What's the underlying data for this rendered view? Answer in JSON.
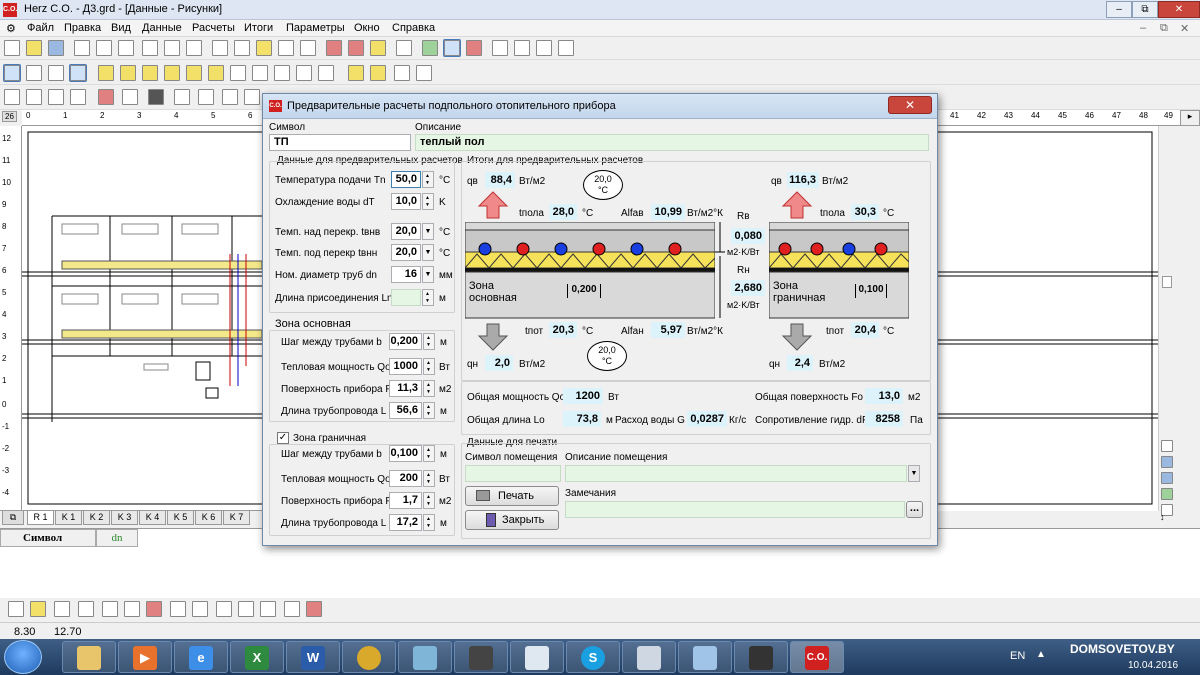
{
  "window": {
    "title": "Herz C.O. - Д3.grd - [Данные - Рисунки]",
    "logo": "C.O.",
    "min": "‒",
    "max": "⧉",
    "close": "✕"
  },
  "menu": [
    "Файл",
    "Правка",
    "Вид",
    "Данные",
    "Расчеты",
    "Итоги",
    "Параметры",
    "Окно",
    "Справка"
  ],
  "ruler_x": [
    "26",
    "0",
    "1",
    "2",
    "3",
    "4",
    "5",
    "6",
    "7",
    "8",
    "9",
    "10",
    "41",
    "42",
    "43",
    "44",
    "45",
    "46",
    "47",
    "48",
    "49",
    "50"
  ],
  "ruler_y": [
    "12",
    "11",
    "10",
    "9",
    "8",
    "7",
    "6",
    "5",
    "4",
    "3",
    "2",
    "1",
    "0",
    "-1",
    "-2",
    "-3",
    "-4"
  ],
  "sheet_tabs": [
    "R 1",
    "K 1",
    "K 2",
    "K 3",
    "K 4",
    "K 5",
    "K 6",
    "K 7"
  ],
  "grid": {
    "col1": "Символ",
    "col2": "dn"
  },
  "status": {
    "x": "8.30",
    "y": "12.70"
  },
  "taskbar": {
    "lang": "EN",
    "site": "DOMSOVETOV.BY",
    "date": "10.04.2016",
    "co_label": "C.O."
  },
  "dialog": {
    "title": "Предварительные расчеты подпольного отопительного прибора",
    "close": "✕",
    "symbol_label": "Символ",
    "symbol_value": "ТП",
    "desc_label": "Описание",
    "desc_value": "теплый пол",
    "left": {
      "section_title": "Данные для предварительных расчетов",
      "rows": [
        {
          "label": "Температура подачи  Tn",
          "value": "50,0",
          "unit": "°С",
          "ctl": "spin"
        },
        {
          "label": "Охлаждение воды dT",
          "value": "10,0",
          "unit": "K",
          "ctl": "spin"
        },
        {
          "label": "Темп. над перекр. tвнв",
          "value": "20,0",
          "unit": "°С",
          "ctl": "drop"
        },
        {
          "label": "Темп. под перекр tвнн",
          "value": "20,0",
          "unit": "°С",
          "ctl": "drop"
        },
        {
          "label": "Ном. диаметр труб dn",
          "value": "16",
          "unit": "мм",
          "ctl": "drop"
        },
        {
          "label": "Длина присоединения Ln",
          "value": "",
          "unit": "м",
          "ctl": "spin"
        }
      ],
      "main_zone": {
        "title": "Зона основная",
        "rows": [
          {
            "label": "Шаг между трубами b",
            "value": "0,200",
            "unit": "м"
          },
          {
            "label": "Тепловая мощность Qo",
            "value": "1000",
            "unit": "Вт"
          },
          {
            "label": "Поверхность прибора F",
            "value": "11,3",
            "unit": "м2"
          },
          {
            "label": "Длина трубопровода L",
            "value": "56,6",
            "unit": "м"
          }
        ]
      },
      "edge_zone": {
        "title": "Зона граничная",
        "checked": "✓",
        "rows": [
          {
            "label": "Шаг между трубами b",
            "value": "0,100",
            "unit": "м"
          },
          {
            "label": "Тепловая мощность Qo",
            "value": "200",
            "unit": "Вт"
          },
          {
            "label": "Поверхность прибора F",
            "value": "1,7",
            "unit": "м2"
          },
          {
            "label": "Длина трубопровода L",
            "value": "17,2",
            "unit": "м"
          }
        ]
      }
    },
    "right": {
      "section_title": "Итоги для предварительных расчетов",
      "main": {
        "qv_label": "qв",
        "qv": "88,4",
        "qv_unit": "Вт/м2",
        "temp_top": "20,0",
        "temp_unit": "°С",
        "tpola_label": "tпола",
        "tpola": "28,0",
        "tpola_unit": "°С",
        "alfav_label": "Alfав",
        "alfav": "10,99",
        "alfa_unit": "Вт/м2°К",
        "zone_label": "Зона основная",
        "spacing": "0,200",
        "tpot_label": "tпот",
        "tpot": "20,3",
        "tpot_unit": "°С",
        "alfan_label": "Alfaн",
        "alfan": "5,97",
        "temp_bottom": "20,0",
        "qn_label": "qн",
        "qn": "2,0",
        "qn_unit": "Вт/м2"
      },
      "resist": {
        "rv_label": "Rв",
        "rv": "0,080",
        "rn_label": "Rн",
        "rn": "2,680",
        "unit": "м2·K/Вт"
      },
      "edge": {
        "qv_label": "qв",
        "qv": "116,3",
        "qv_unit": "Вт/м2",
        "tpola_label": "tпола",
        "tpola": "30,3",
        "tpola_unit": "°С",
        "zone_label": "Зона граничная",
        "spacing": "0,100",
        "tpot_label": "tпот",
        "tpot": "20,4",
        "tpot_unit": "°С",
        "qn_label": "qн",
        "qn": "2,4",
        "qn_unit": "Вт/м2"
      },
      "totals": {
        "power_label": "Общая мощность Qo",
        "power": "1200",
        "power_unit": "Вт",
        "area_label": "Общая поверхность Fo",
        "area": "13,0",
        "area_unit": "м2",
        "length_label": "Общая длина Lo",
        "length": "73,8",
        "length_unit": "м",
        "flow_label": "Расход воды G",
        "flow": "0,0287",
        "flow_unit": "Кг/с",
        "hydr_label": "Сопротивление гидр. dP",
        "hydr": "8258",
        "hydr_unit": "Па"
      }
    },
    "print": {
      "section_title": "Данные для печати",
      "room_symbol_label": "Символ помещения",
      "room_desc_label": "Описание помещения",
      "notes_label": "Замечания",
      "print_button": "Печать",
      "close_button": "Закрыть",
      "more": "..."
    }
  }
}
